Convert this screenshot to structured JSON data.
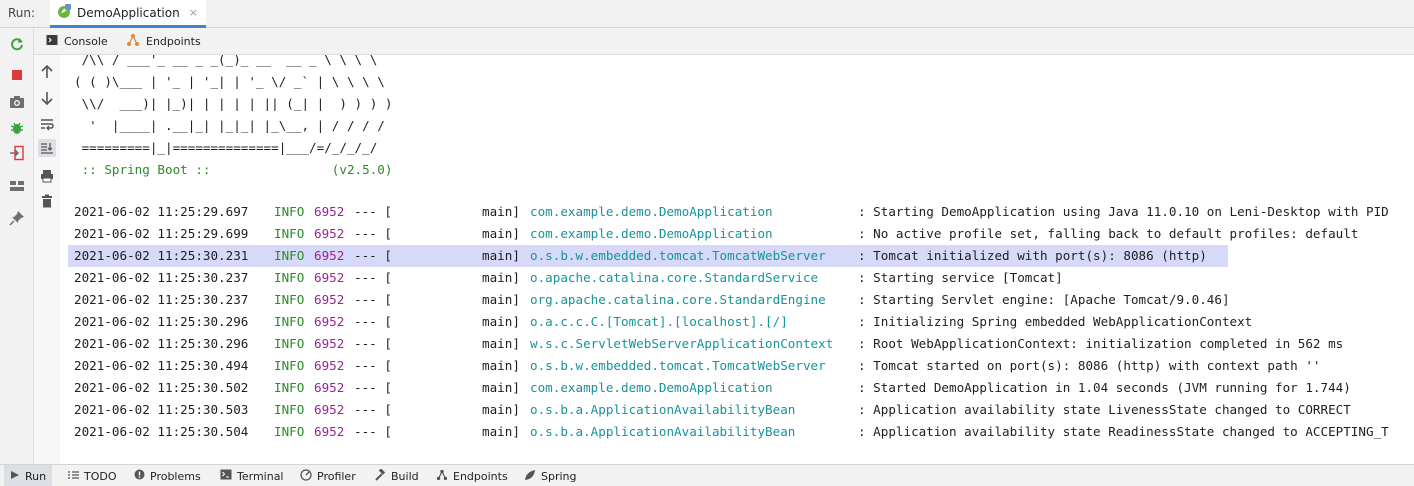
{
  "run_bar": {
    "label": "Run:",
    "tab_title": "DemoApplication",
    "close": "×"
  },
  "sub_tabs": [
    {
      "label": "Console",
      "icon": "console-icon"
    },
    {
      "label": "Endpoints",
      "icon": "endpoints-icon"
    }
  ],
  "banner": [
    " /\\\\ / ___'_ __ _ _(_)_ __  __ _ \\ \\ \\ \\",
    "( ( )\\___ | '_ | '_| | '_ \\/ _` | \\ \\ \\ \\",
    " \\\\/  ___)| |_)| | | | | || (_| |  ) ) ) )",
    "  '  |____| .__|_| |_|_| |_\\__, | / / / /",
    " =========|_|==============|___/=/_/_/_/",
    " :: Spring Boot ::                (v2.5.0)"
  ],
  "logs": [
    {
      "ts": "2021-06-02 11:25:29.697",
      "level": "INFO",
      "pid": "6952",
      "sep": "--- [",
      "thread": "main]",
      "logger": "com.example.demo.DemoApplication",
      "msg": ": Starting DemoApplication using Java 11.0.10 on Leni-Desktop with PID"
    },
    {
      "ts": "2021-06-02 11:25:29.699",
      "level": "INFO",
      "pid": "6952",
      "sep": "--- [",
      "thread": "main]",
      "logger": "com.example.demo.DemoApplication",
      "msg": ": No active profile set, falling back to default profiles: default"
    },
    {
      "ts": "2021-06-02 11:25:30.231",
      "level": "INFO",
      "pid": "6952",
      "sep": "--- [",
      "thread": "main]",
      "logger": "o.s.b.w.embedded.tomcat.TomcatWebServer",
      "msg": ": Tomcat initialized with port(s): 8086 (http)",
      "highlight": true
    },
    {
      "ts": "2021-06-02 11:25:30.237",
      "level": "INFO",
      "pid": "6952",
      "sep": "--- [",
      "thread": "main]",
      "logger": "o.apache.catalina.core.StandardService",
      "msg": ": Starting service [Tomcat]"
    },
    {
      "ts": "2021-06-02 11:25:30.237",
      "level": "INFO",
      "pid": "6952",
      "sep": "--- [",
      "thread": "main]",
      "logger": "org.apache.catalina.core.StandardEngine",
      "msg": ": Starting Servlet engine: [Apache Tomcat/9.0.46]"
    },
    {
      "ts": "2021-06-02 11:25:30.296",
      "level": "INFO",
      "pid": "6952",
      "sep": "--- [",
      "thread": "main]",
      "logger": "o.a.c.c.C.[Tomcat].[localhost].[/]",
      "msg": ": Initializing Spring embedded WebApplicationContext"
    },
    {
      "ts": "2021-06-02 11:25:30.296",
      "level": "INFO",
      "pid": "6952",
      "sep": "--- [",
      "thread": "main]",
      "logger": "w.s.c.ServletWebServerApplicationContext",
      "msg": ": Root WebApplicationContext: initialization completed in 562 ms"
    },
    {
      "ts": "2021-06-02 11:25:30.494",
      "level": "INFO",
      "pid": "6952",
      "sep": "--- [",
      "thread": "main]",
      "logger": "o.s.b.w.embedded.tomcat.TomcatWebServer",
      "msg": ": Tomcat started on port(s): 8086 (http) with context path ''"
    },
    {
      "ts": "2021-06-02 11:25:30.502",
      "level": "INFO",
      "pid": "6952",
      "sep": "--- [",
      "thread": "main]",
      "logger": "com.example.demo.DemoApplication",
      "msg": ": Started DemoApplication in 1.04 seconds (JVM running for 1.744)"
    },
    {
      "ts": "2021-06-02 11:25:30.503",
      "level": "INFO",
      "pid": "6952",
      "sep": "--- [",
      "thread": "main]",
      "logger": "o.s.b.a.ApplicationAvailabilityBean",
      "msg": ": Application availability state LivenessState changed to CORRECT"
    },
    {
      "ts": "2021-06-02 11:25:30.504",
      "level": "INFO",
      "pid": "6952",
      "sep": "--- [",
      "thread": "main]",
      "logger": "o.s.b.a.ApplicationAvailabilityBean",
      "msg": ": Application availability state ReadinessState changed to ACCEPTING_T"
    }
  ],
  "bottom_tabs": [
    {
      "label": "Run",
      "icon": "run-icon",
      "active": true
    },
    {
      "label": "TODO",
      "icon": "list-icon"
    },
    {
      "label": "Problems",
      "icon": "problems-icon"
    },
    {
      "label": "Terminal",
      "icon": "terminal-icon"
    },
    {
      "label": "Profiler",
      "icon": "profiler-icon"
    },
    {
      "label": "Build",
      "icon": "hammer-icon"
    },
    {
      "label": "Endpoints",
      "icon": "endpoints-icon"
    },
    {
      "label": "Spring",
      "icon": "spring-leaf-icon"
    }
  ],
  "colors": {
    "accent": "#4083c9",
    "highlight_row": "#d6d9f7",
    "log_level": "#2b8a2b",
    "pid": "#9b2393",
    "logger": "#17939b",
    "stop": "#db3b3b",
    "rerun": "#3aa340"
  }
}
